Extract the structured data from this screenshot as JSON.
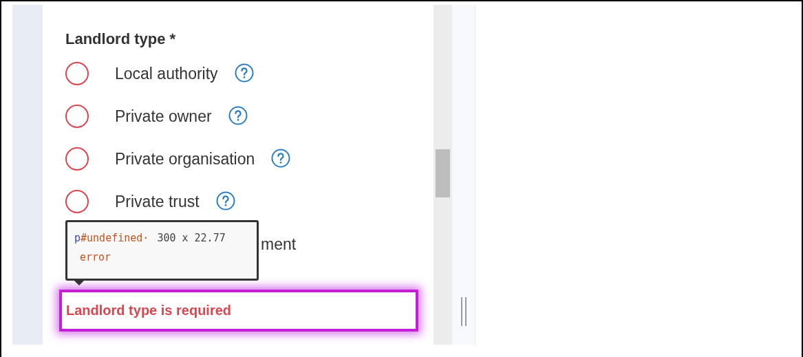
{
  "field": {
    "label": "Landlord type *"
  },
  "options": [
    {
      "kind": "full",
      "label": "Local authority",
      "selected": false
    },
    {
      "kind": "full",
      "label": "Private owner",
      "selected": false
    },
    {
      "kind": "full",
      "label": "Private organisation",
      "selected": false
    },
    {
      "kind": "full",
      "label": "Private trust",
      "selected": false
    },
    {
      "kind": "covered",
      "label": "ment"
    }
  ],
  "tooltip": {
    "tag": "p",
    "id": "#undefined·",
    "size": "300 x 22.77",
    "class": "error"
  },
  "error": {
    "message": "Landlord type is required"
  }
}
